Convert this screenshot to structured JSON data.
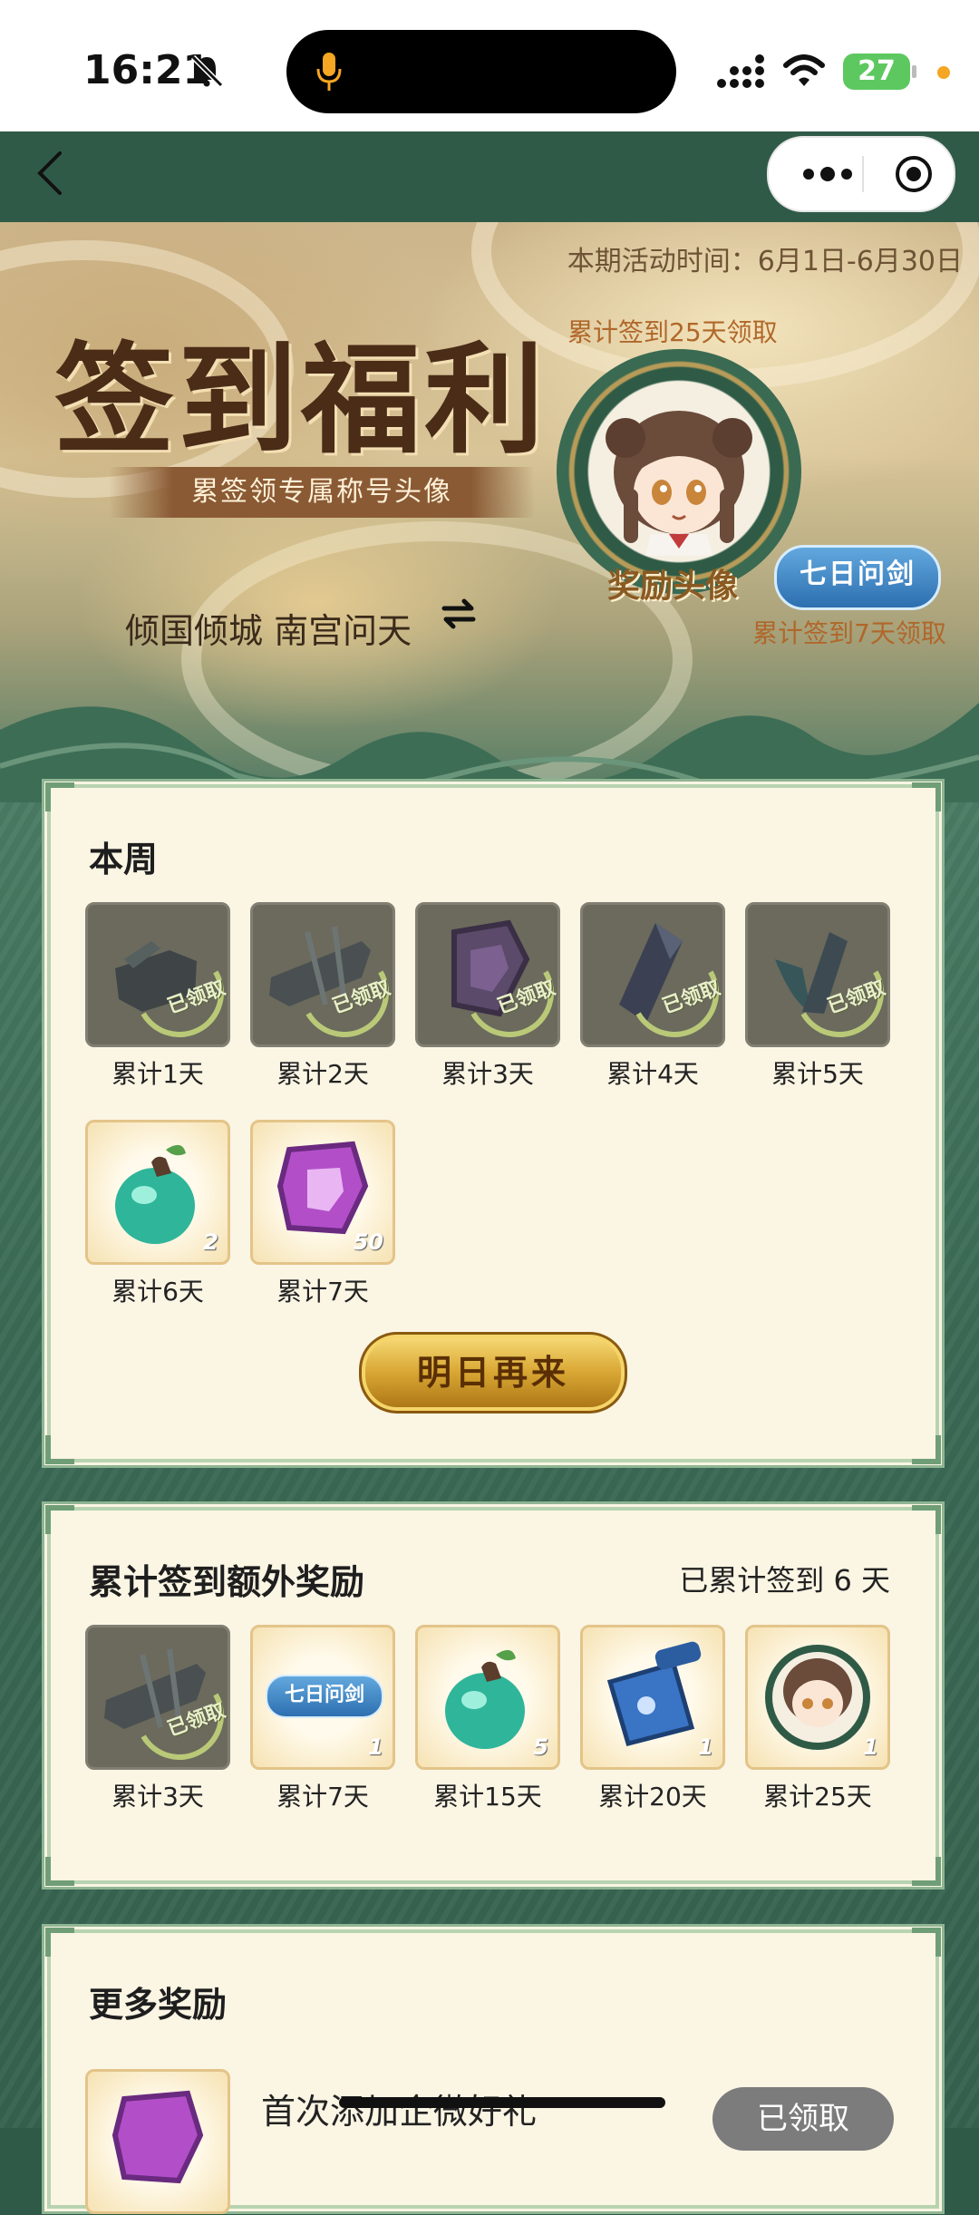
{
  "status": {
    "time": "16:21",
    "battery": "27"
  },
  "banner": {
    "activity_time": "本期活动时间：6月1日-6月30日",
    "title": "签到福利",
    "subtitle": "累签领专属称号头像",
    "player_title": "倾国倾城 南宫问天",
    "note_25": "累计签到25天领取",
    "avatar_label": "奖励头像",
    "title_badge": "七日问剑",
    "note_7": "累计签到7天领取"
  },
  "week": {
    "title": "本周",
    "items": [
      {
        "label": "累计1天",
        "state": "claimed",
        "stamp": "已领取",
        "icon": "stone-altar-icon"
      },
      {
        "label": "累计2天",
        "state": "claimed",
        "stamp": "已领取",
        "icon": "weapon-rack-icon"
      },
      {
        "label": "累计3天",
        "state": "claimed",
        "stamp": "已领取",
        "icon": "jade-token-icon"
      },
      {
        "label": "累计4天",
        "state": "claimed",
        "stamp": "已领取",
        "icon": "crystal-icon"
      },
      {
        "label": "累计5天",
        "state": "claimed",
        "stamp": "已领取",
        "icon": "leaf-crystal-icon"
      },
      {
        "label": "累计6天",
        "state": "available",
        "qty": "2",
        "icon": "gourd-icon"
      },
      {
        "label": "累计7天",
        "state": "available",
        "qty": "50",
        "icon": "purple-rune-icon"
      }
    ],
    "button": "明日再来"
  },
  "extra": {
    "title": "累计签到额外奖励",
    "progress_text": "已累计签到 6 天",
    "items": [
      {
        "label": "累计3天",
        "state": "claimed",
        "stamp": "已领取",
        "icon": "weapon-rack-icon"
      },
      {
        "label": "累计7天",
        "state": "available",
        "qty": "1",
        "badge": "七日问剑",
        "icon": "title-badge-icon"
      },
      {
        "label": "累计15天",
        "state": "available",
        "qty": "5",
        "icon": "gourd-icon"
      },
      {
        "label": "累计20天",
        "state": "available",
        "qty": "1",
        "icon": "scroll-icon"
      },
      {
        "label": "累计25天",
        "state": "available",
        "qty": "1",
        "icon": "avatar-frame-icon"
      }
    ]
  },
  "more": {
    "title": "更多奖励",
    "item_text": "首次添加企微好礼",
    "claim_label": "已领取"
  }
}
